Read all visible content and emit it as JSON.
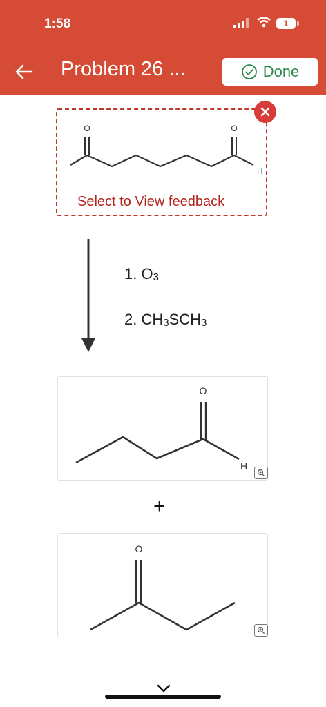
{
  "status_bar": {
    "time": "1:58",
    "battery_badge": "1"
  },
  "header": {
    "title": "Problem 26 ...",
    "done_label": "Done"
  },
  "answer": {
    "feedback_text": "Select to View feedback",
    "molecule": {
      "atom_O_left": "O",
      "atom_O_right": "O",
      "atom_H": "H"
    }
  },
  "reagents": [
    {
      "num": "1. ",
      "parts": [
        "O",
        "3"
      ]
    },
    {
      "num": "2. ",
      "parts": [
        "CH",
        "3",
        "SCH",
        "3"
      ]
    }
  ],
  "products": [
    {
      "atoms": {
        "O": "O",
        "H": "H"
      }
    },
    {
      "atoms": {
        "O": "O"
      }
    }
  ],
  "plus_sign": "+",
  "colors": {
    "header": "#d64b35",
    "done_text": "#2e8a4f",
    "error": "#c0392b"
  }
}
